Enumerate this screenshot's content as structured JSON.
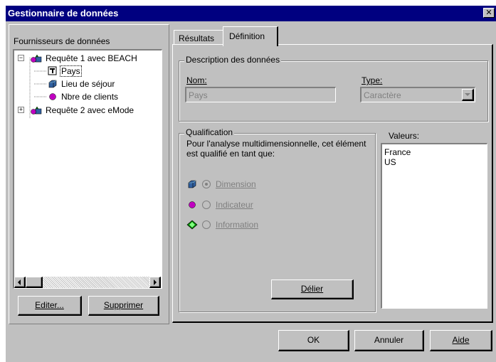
{
  "window": {
    "title": "Gestionnaire de données"
  },
  "left_panel": {
    "label": "Fournisseurs de données",
    "tree": [
      {
        "label": "Requête 1 avec BEACH",
        "expander": "−"
      },
      {
        "label": "Pays"
      },
      {
        "label": "Lieu de séjour"
      },
      {
        "label": "Nbre de clients"
      },
      {
        "label": "Requête 2 avec eMode",
        "expander": "+"
      }
    ],
    "edit_button": "Editer...",
    "delete_button": "Supprimer"
  },
  "tabs": [
    {
      "label": "Résultats"
    },
    {
      "label": "Définition"
    }
  ],
  "description_group": {
    "title": "Description des données",
    "name_label": "Nom:",
    "name_value": "Pays",
    "type_label": "Type:",
    "type_value": "Caractère"
  },
  "qualification_group": {
    "title": "Qualification",
    "text": "Pour l'analyse multidimensionnelle, cet élément est qualifié en tant que:",
    "options": [
      {
        "label": "Dimension",
        "selected": true
      },
      {
        "label": "Indicateur",
        "selected": false
      },
      {
        "label": "Information",
        "selected": false
      }
    ],
    "unlink_button": "Délier"
  },
  "values": {
    "label": "Valeurs:",
    "items": [
      "France",
      "US"
    ]
  },
  "footer": {
    "ok": "OK",
    "cancel": "Annuler",
    "help": "Aide"
  },
  "colors": {
    "titlebar": "#000080",
    "face": "#c0c0c0",
    "dimension_icon": "#3060a0",
    "indicator_icon": "#c000c0",
    "information_icon": "#008000"
  }
}
